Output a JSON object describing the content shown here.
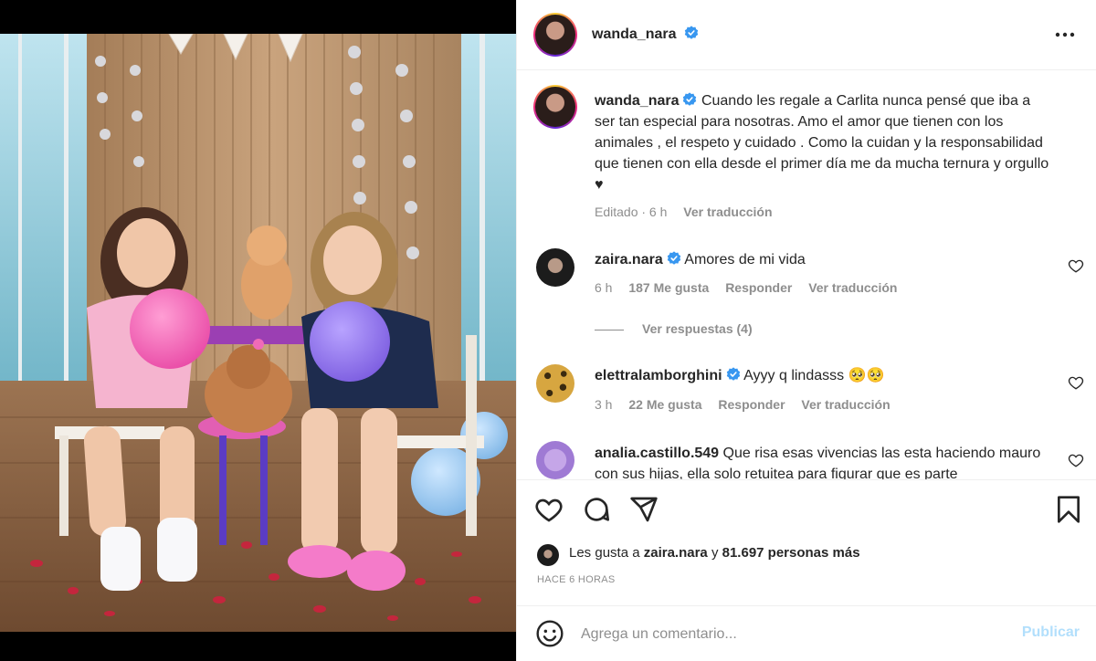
{
  "post": {
    "author": "wanda_nara",
    "caption": "Cuando les regale a Carlita nunca pensé que iba a ser tan especial para nosotras. Amo el amor que tienen con los animales , el respeto y cuidado . Como la cuidan y la responsabilidad que tienen con ella desde el primer día me da mucha ternura y orgullo ♥",
    "edited": "Editado · 6 h",
    "see_translation": "Ver traducción"
  },
  "comments": [
    {
      "user": "zaira.nara",
      "text": "Amores de mi vida",
      "time": "6 h",
      "likes": "187 Me gusta",
      "reply": "Responder",
      "translate": "Ver traducción",
      "replies": "Ver respuestas (4)"
    },
    {
      "user": "elettralamborghini",
      "text": "Ayyy q lindasss 🥺🥺",
      "time": "3 h",
      "likes": "22 Me gusta",
      "reply": "Responder",
      "translate": "Ver traducción"
    },
    {
      "user": "analia.castillo.549",
      "text": "Que risa esas vivencias las esta haciendo mauro con sus hijas, ella solo retuitea para figurar que es parte"
    }
  ],
  "likes": {
    "prefix": "Les gusta a",
    "user": "zaira.nara",
    "joiner": "y",
    "others": "81.697 personas más"
  },
  "time_ago": "HACE 6 HORAS",
  "comment_box": {
    "placeholder": "Agrega un comentario...",
    "publish": "Publicar"
  },
  "icons": {
    "more": "more-options-icon",
    "like": "heart-icon",
    "comment": "comment-icon",
    "share": "share-icon",
    "save": "bookmark-icon",
    "emoji": "emoji-icon",
    "verified": "verified-badge-icon"
  },
  "colors": {
    "verified": "#3897f0",
    "muted": "#8e8e8e",
    "publish_disabled": "#b2dffc"
  }
}
